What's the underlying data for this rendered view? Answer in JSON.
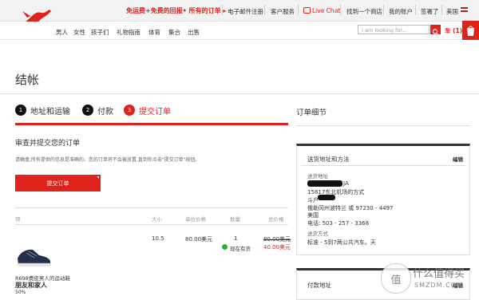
{
  "header": {
    "promo": "免运费+免费的回报• 所有的订单 ▸",
    "links": [
      "电子邮件注册",
      "客户服务",
      "Live Chat",
      "找到一个商店",
      "我的账户",
      "签署了",
      "美国"
    ],
    "nav": [
      "男人",
      "女性",
      "孩子们",
      "礼物指南",
      "体育",
      "集合",
      "出售"
    ],
    "search_placeholder": "I am looking for...",
    "cart": "车 (1)"
  },
  "page": {
    "title": "结帐",
    "steps": [
      {
        "num": "1",
        "label": "地址和运输"
      },
      {
        "num": "2",
        "label": "付款"
      },
      {
        "num": "3",
        "label": "提交订单"
      }
    ],
    "summary_title": "订单细节",
    "review_heading": "审查并提交您的订单",
    "review_note": "请确盒,所有提供的信息是准确的。您的订单将不会被放置,直到你点击\"提交订单\"按钮。",
    "submit_label": "提交订单"
  },
  "table": {
    "headers": [
      "项",
      "大小",
      "单位价格",
      "数量",
      "总价格"
    ],
    "row": {
      "size": "10.5",
      "unit_price": "80.00美元",
      "qty": "1",
      "stock": "现在有货",
      "old_price": "80.00美元",
      "new_price": "40.00美元",
      "product_name": "R698费皮男人的运动鞋",
      "product_variant": "朋友和家人",
      "discount": "50%"
    }
  },
  "shipping": {
    "title": "送货地址和方法",
    "edit": "编辑",
    "addr_label": "送货地址",
    "line1": "JA",
    "line2": "15817东北机场的方式",
    "line3": "斗户",
    "line4": "俄勒冈州波特兰 或 97230 - 4497",
    "country": "美国",
    "phone": "电话: 503 - 257 - 3368",
    "method_label": "送货方式",
    "method": "标准 - 5到7两公共汽车。天"
  },
  "payment": {
    "title": "付款地址",
    "edit": "编辑"
  },
  "watermark": {
    "badge": "值",
    "name": "什么值得买",
    "url": "SMZDM.COM"
  }
}
